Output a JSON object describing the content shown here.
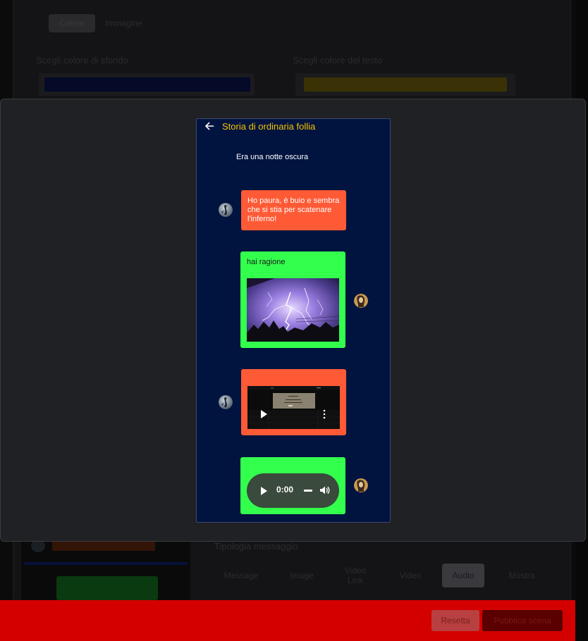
{
  "background": {
    "tabs": [
      "Colore",
      "Immagine"
    ],
    "bg_color_label": "Scegli colore di sfondo",
    "text_color_label": "Scegli colore del testo",
    "bg_color": "#0a1a6a",
    "text_color": "#f5c400",
    "types_heading": "Tipologia messaggio",
    "types": [
      "Message",
      "Image",
      "Video Link",
      "Video",
      "Audio",
      "Mostra"
    ],
    "selected_type": "Audio",
    "reset_label": "Resetta",
    "publish_label": "Pubblica scena"
  },
  "modal": {
    "chat": {
      "title": "Storia di ordinaria follia",
      "subtitle": "Era una notte oscura",
      "messages": [
        {
          "type": "text",
          "sender": "left",
          "text": "Ho paura, è buio e sembra che si stia per scatenare l'inferno!",
          "bubble_color": "#ff5a36"
        },
        {
          "type": "image",
          "sender": "right",
          "text": "hai ragione",
          "image": "lightning-photo",
          "bubble_color": "#33ff4d"
        },
        {
          "type": "video",
          "sender": "left",
          "bubble_color": "#ff5a36"
        },
        {
          "type": "audio",
          "sender": "right",
          "time": "0:00",
          "bubble_color": "#33ff4d"
        }
      ]
    },
    "colors": {
      "title": "#f5c400",
      "chat_bg": "#01133f",
      "modal_bg": "#202124"
    }
  }
}
